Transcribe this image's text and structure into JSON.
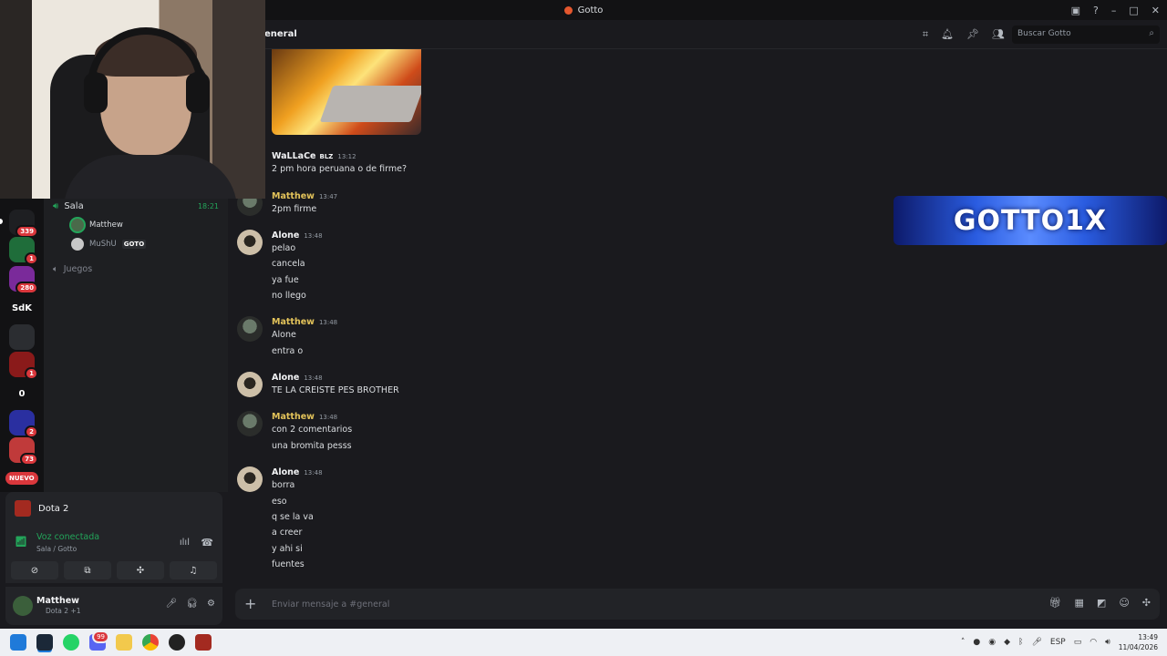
{
  "window": {
    "title": "Gotto"
  },
  "header": {
    "channel_name": "eneral",
    "search_placeholder": "Buscar Gotto"
  },
  "servers": [
    {
      "label": "",
      "badge": "339",
      "color": "#1e1f22"
    },
    {
      "label": "",
      "badge": "1",
      "color": "#1f6d3a"
    },
    {
      "label": "",
      "badge": "280",
      "color": "#7a2a9a"
    },
    {
      "label": "SdK",
      "badge": "",
      "color": "#121214"
    },
    {
      "label": "",
      "badge": "",
      "color": "#2b2d31"
    },
    {
      "label": "",
      "badge": "1",
      "color": "#8a1a1a"
    },
    {
      "label": "0",
      "badge": "",
      "color": "#121214"
    },
    {
      "label": "",
      "badge": "2",
      "color": "#2a2fa0"
    },
    {
      "label": "",
      "badge": "73",
      "color": "#c03a3a"
    }
  ],
  "servers_new_label": "NUEVO",
  "sidebar": {
    "voice_channel": "Sala",
    "voice_timer": "18:21",
    "voice_users": [
      {
        "name": "Matthew",
        "tag": ""
      },
      {
        "name": "MuShU",
        "tag": "GOTO"
      }
    ],
    "category": "Juegos"
  },
  "activity": {
    "game": "Dota 2"
  },
  "voice_panel": {
    "status": "Voz conectada",
    "location": "Sala / Gotto"
  },
  "user_panel": {
    "name": "Matthew",
    "status": "Dota 2 +1"
  },
  "banner": {
    "text": "GOTTO1X"
  },
  "messages": [
    {
      "author": "WaLLaCe",
      "tag": "BLZ",
      "time": "13:12",
      "lines": [
        "2 pm hora peruana o de firme?"
      ]
    },
    {
      "author": "Matthew",
      "time": "13:47",
      "lines": [
        "2pm firme"
      ]
    },
    {
      "author": "Alone",
      "time": "13:48",
      "lines": [
        "pelao",
        "cancela",
        "ya fue",
        "no llego"
      ]
    },
    {
      "author": "Matthew",
      "time": "13:48",
      "lines": [
        "Alone",
        "entra o"
      ]
    },
    {
      "author": "Alone",
      "time": "13:48",
      "lines": [
        "TE LA CREISTE PES BROTHER"
      ]
    },
    {
      "author": "Matthew",
      "time": "13:48",
      "lines": [
        "con 2 comentarios",
        "una bromita pesss"
      ]
    },
    {
      "author": "Alone",
      "time": "13:48",
      "lines": [
        "borra",
        "eso",
        "q se la va",
        "a creer",
        "y ahi si",
        "fuentes"
      ]
    }
  ],
  "composer": {
    "placeholder": "Enviar mensaje a #general"
  },
  "taskbar": {
    "lang": "ESP",
    "time": "13:49",
    "date": "11/04/2026",
    "notif_badge": "99"
  }
}
